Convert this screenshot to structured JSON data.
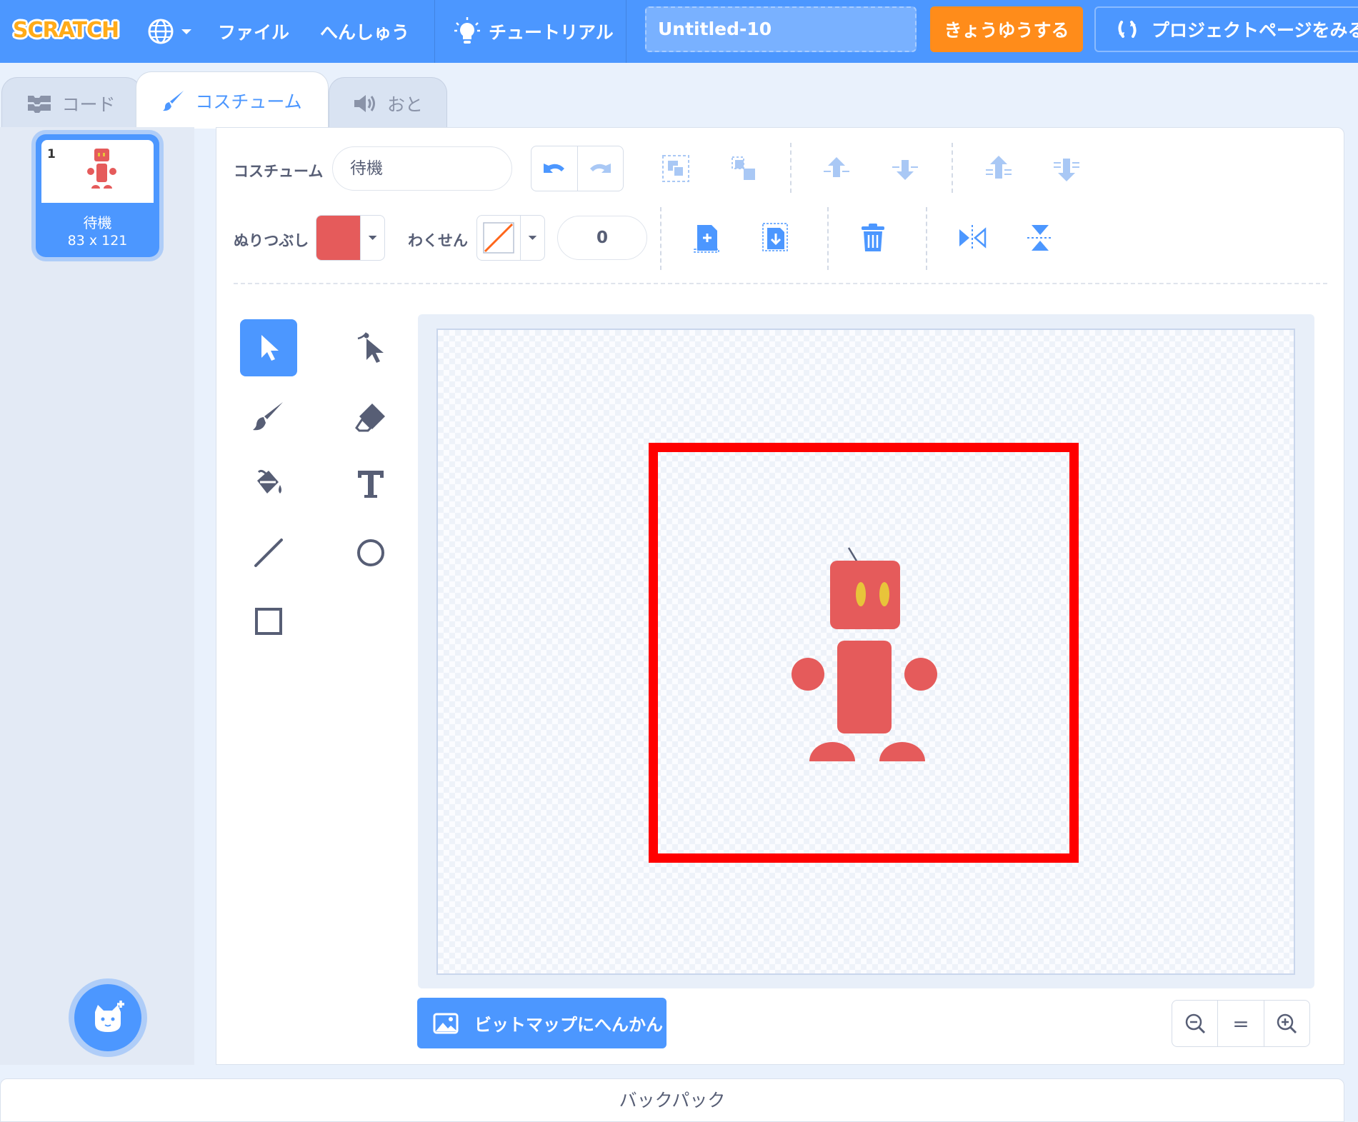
{
  "menubar": {
    "logo_text": "SCRATCH",
    "file_label": "ファイル",
    "edit_label": "へんしゅう",
    "tutorial_label": "チュートリアル",
    "project_title": "Untitled-10",
    "share_label": "きょうゆうする",
    "see_project_label": "プロジェクトページをみる"
  },
  "tabs": [
    {
      "label": "コード"
    },
    {
      "label": "コスチューム"
    },
    {
      "label": "おと"
    }
  ],
  "costume_list": {
    "items": [
      {
        "number": "1",
        "name": "待機",
        "size": "83 x 121"
      }
    ]
  },
  "editor": {
    "costume_label": "コスチューム",
    "costume_name": "待機",
    "fill_label": "ぬりつぶし",
    "fill_color": "#e55b5b",
    "outline_label": "わくせん",
    "outline_width": "0",
    "convert_label": "ビットマップにへんかん",
    "zoom_reset_label": "="
  },
  "colors": {
    "accent": "#4c97ff",
    "share": "#ff8c1a",
    "robot": "#e55b5b",
    "robot_eyes": "#e8c43a",
    "highlight": "#ff0000"
  },
  "backpack": {
    "label": "バックパック"
  }
}
